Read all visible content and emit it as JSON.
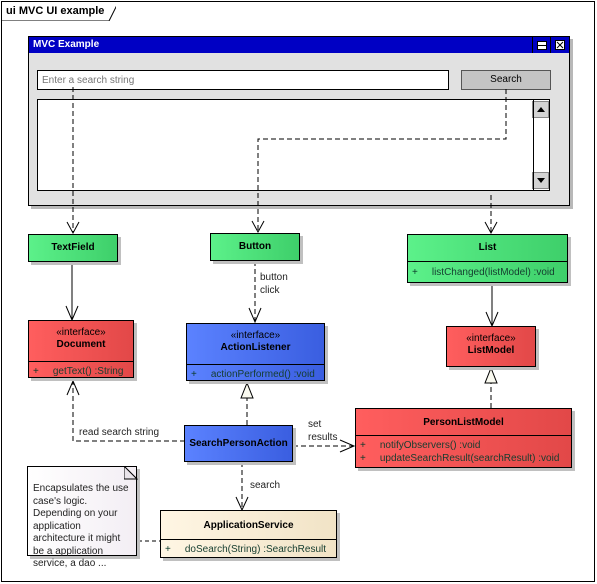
{
  "diagram": {
    "frame_title": "ui MVC UI example"
  },
  "window": {
    "title": "MVC Example",
    "minimize_icon": "minimize-icon",
    "close_icon": "close-icon",
    "search_input": {
      "value": "",
      "placeholder": "Enter a search string"
    },
    "search_button_label": "Search",
    "scroll_up_icon": "arrow-up-icon",
    "scroll_down_icon": "arrow-down-icon"
  },
  "classes": {
    "textfield": {
      "name": "TextField"
    },
    "button": {
      "name": "Button"
    },
    "list": {
      "name": "List",
      "operations": [
        {
          "visibility": "+",
          "signature": "listChanged(listModel)  :void"
        }
      ]
    },
    "document": {
      "stereotype": "«interface»",
      "name": "Document",
      "operations": [
        {
          "visibility": "+",
          "signature": "getText()  :String"
        }
      ]
    },
    "action_listener": {
      "stereotype": "«interface»",
      "name": "ActionListener",
      "operations": [
        {
          "visibility": "+",
          "signature": "actionPerformed()  :void"
        }
      ]
    },
    "list_model": {
      "stereotype": "«interface»",
      "name": "ListModel"
    },
    "search_person_action": {
      "name": "SearchPersonAction"
    },
    "person_list_model": {
      "name": "PersonListModel",
      "operations": [
        {
          "visibility": "+",
          "signature": "notifyObservers()  :void"
        },
        {
          "visibility": "+",
          "signature": "updateSearchResult(searchResult)  :void"
        }
      ]
    },
    "application_service": {
      "name": "ApplicationService",
      "operations": [
        {
          "visibility": "+",
          "signature": "doSearch(String)  :SearchResult"
        }
      ]
    }
  },
  "connector_labels": {
    "button_click_1": "button",
    "button_click_2": "click",
    "read_search_string": "read search string",
    "set_results_1": "set",
    "set_results_2": "results",
    "search": "search"
  },
  "note": {
    "text": "Encapsulates the use case's logic. Depending on your application architecture it might be a application service, a dao ..."
  },
  "colors": {
    "view_green": "#4ee07a",
    "interface_red": "#f05050",
    "controller_blue": "#4a70f0",
    "service_beige": "#f8ecd4",
    "window_title_blue": "#0000c4"
  }
}
